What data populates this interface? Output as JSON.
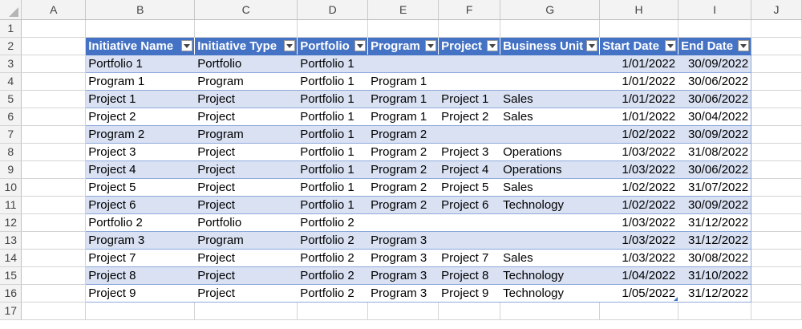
{
  "columns": [
    "A",
    "B",
    "C",
    "D",
    "E",
    "F",
    "G",
    "H",
    "I",
    "J"
  ],
  "rows": [
    "1",
    "2",
    "3",
    "4",
    "5",
    "6",
    "7",
    "8",
    "9",
    "10",
    "11",
    "12",
    "13",
    "14",
    "15",
    "16",
    "17"
  ],
  "table": {
    "headers": [
      "Initiative Name",
      "Initiative Type",
      "Portfolio",
      "Program",
      "Project",
      "Business Unit",
      "Start Date",
      "End Date"
    ],
    "records": [
      [
        "Portfolio 1",
        "Portfolio",
        "Portfolio 1",
        "",
        "",
        "",
        "1/01/2022",
        "30/09/2022"
      ],
      [
        "Program 1",
        "Program",
        "Portfolio 1",
        "Program 1",
        "",
        "",
        "1/01/2022",
        "30/06/2022"
      ],
      [
        "Project 1",
        "Project",
        "Portfolio 1",
        "Program 1",
        "Project 1",
        "Sales",
        "1/01/2022",
        "30/06/2022"
      ],
      [
        "Project 2",
        "Project",
        "Portfolio 1",
        "Program 1",
        "Project 2",
        "Sales",
        "1/01/2022",
        "30/04/2022"
      ],
      [
        "Program 2",
        "Program",
        "Portfolio 1",
        "Program 2",
        "",
        "",
        "1/02/2022",
        "30/09/2022"
      ],
      [
        "Project 3",
        "Project",
        "Portfolio 1",
        "Program 2",
        "Project 3",
        "Operations",
        "1/03/2022",
        "31/08/2022"
      ],
      [
        "Project 4",
        "Project",
        "Portfolio 1",
        "Program 2",
        "Project 4",
        "Operations",
        "1/03/2022",
        "30/06/2022"
      ],
      [
        "Project 5",
        "Project",
        "Portfolio 1",
        "Program 2",
        "Project 5",
        "Sales",
        "1/02/2022",
        "31/07/2022"
      ],
      [
        "Project 6",
        "Project",
        "Portfolio 1",
        "Program 2",
        "Project 6",
        "Technology",
        "1/02/2022",
        "30/09/2022"
      ],
      [
        "Portfolio 2",
        "Portfolio",
        "Portfolio 2",
        "",
        "",
        "",
        "1/03/2022",
        "31/12/2022"
      ],
      [
        "Program 3",
        "Program",
        "Portfolio 2",
        "Program 3",
        "",
        "",
        "1/03/2022",
        "31/12/2022"
      ],
      [
        "Project 7",
        "Project",
        "Portfolio 2",
        "Program 3",
        "Project 7",
        "Sales",
        "1/03/2022",
        "30/08/2022"
      ],
      [
        "Project 8",
        "Project",
        "Portfolio 2",
        "Program 3",
        "Project 8",
        "Technology",
        "1/04/2022",
        "31/10/2022"
      ],
      [
        "Project 9",
        "Project",
        "Portfolio 2",
        "Program 3",
        "Project 9",
        "Technology",
        "1/05/2022",
        "31/12/2022"
      ]
    ]
  },
  "colors": {
    "header_fill": "#4472c4",
    "band_fill": "#d9e1f2",
    "border": "#8ea9db"
  },
  "icons": {
    "filter": "chevron-down-icon",
    "corner": "select-all-triangle-icon"
  }
}
